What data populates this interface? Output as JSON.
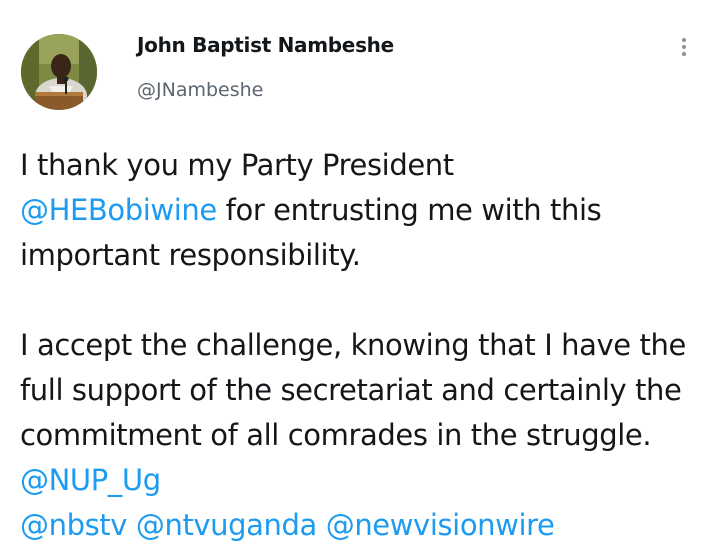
{
  "author": {
    "display_name": "John Baptist Nambeshe",
    "handle": "@JNambeshe"
  },
  "icons": {
    "avatar": "profile-photo",
    "more": "vertical-ellipsis-icon"
  },
  "colors": {
    "text": "#14171a",
    "secondary_text": "#5b6670",
    "link": "#1d9bf0",
    "background": "#ffffff"
  },
  "tweet": {
    "p1": {
      "s1": "I thank you my Party President ",
      "m1": "@HEBobiwine",
      "s2": " for entrusting me with this important responsibility."
    },
    "p2": {
      "s1": "I accept the challenge, knowing that I have the full support of the secretariat and certainly the commitment of all comrades in the struggle. ",
      "m1": "@NUP_Ug",
      "m2": "@nbstv",
      "m3": "@ntvuganda",
      "m4": "@newvisionwire"
    }
  }
}
